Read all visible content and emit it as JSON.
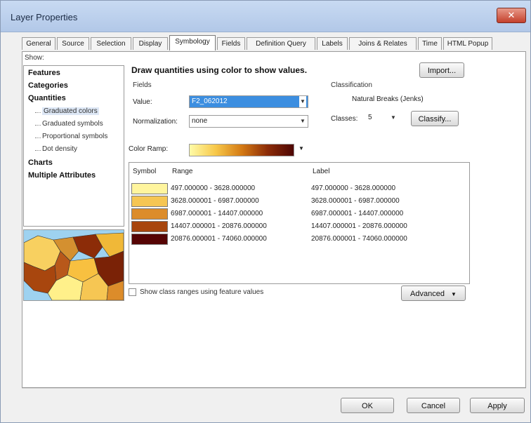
{
  "window": {
    "title": "Layer Properties",
    "close_glyph": "✕"
  },
  "tabs": [
    "General",
    "Source",
    "Selection",
    "Display",
    "Symbology",
    "Fields",
    "Definition Query",
    "Labels",
    "Joins & Relates",
    "Time",
    "HTML Popup"
  ],
  "active_tab": "Symbology",
  "show": {
    "label": "Show:",
    "items": [
      {
        "label": "Features",
        "bold": true
      },
      {
        "label": "Categories",
        "bold": true
      },
      {
        "label": "Quantities",
        "bold": true
      },
      {
        "label": "Graduated colors",
        "sub": true,
        "selected": true
      },
      {
        "label": "Graduated symbols",
        "sub": true
      },
      {
        "label": "Proportional symbols",
        "sub": true
      },
      {
        "label": "Dot density",
        "sub": true
      },
      {
        "label": "Charts",
        "bold": true
      },
      {
        "label": "Multiple Attributes",
        "bold": true
      }
    ]
  },
  "heading": "Draw quantities using color to show values.",
  "import_button": "Import...",
  "fields": {
    "group_label": "Fields",
    "value_label": "Value:",
    "value": "F2_062012",
    "normalization_label": "Normalization:",
    "normalization": "none"
  },
  "classification": {
    "group_label": "Classification",
    "method": "Natural Breaks (Jenks)",
    "classes_label": "Classes:",
    "classes_value": "5",
    "classify_button": "Classify..."
  },
  "color_ramp": {
    "label": "Color Ramp:",
    "colors": [
      "#fffba8",
      "#f7c84a",
      "#d47a14",
      "#8c2c08",
      "#4e0604"
    ]
  },
  "class_table": {
    "headers": [
      "Symbol",
      "Range",
      "Label"
    ],
    "rows": [
      {
        "color": "#fff59e",
        "range": "497.000000 - 3628.000000",
        "label": "497.000000 - 3628.000000"
      },
      {
        "color": "#f6c653",
        "range": "3628.000001 - 6987.000000",
        "label": "3628.000001 - 6987.000000"
      },
      {
        "color": "#dc8c2a",
        "range": "6987.000001 - 14407.000000",
        "label": "6987.000001 - 14407.000000"
      },
      {
        "color": "#a8460e",
        "range": "14407.000001 - 20876.000000",
        "label": "14407.000001 - 20876.000000"
      },
      {
        "color": "#560404",
        "range": "20876.000001 - 74060.000000",
        "label": "20876.000001 - 74060.000000"
      }
    ]
  },
  "show_class_ranges_label": "Show class ranges using feature values",
  "advanced_button": "Advanced",
  "footer": {
    "ok": "OK",
    "cancel": "Cancel",
    "apply": "Apply"
  }
}
